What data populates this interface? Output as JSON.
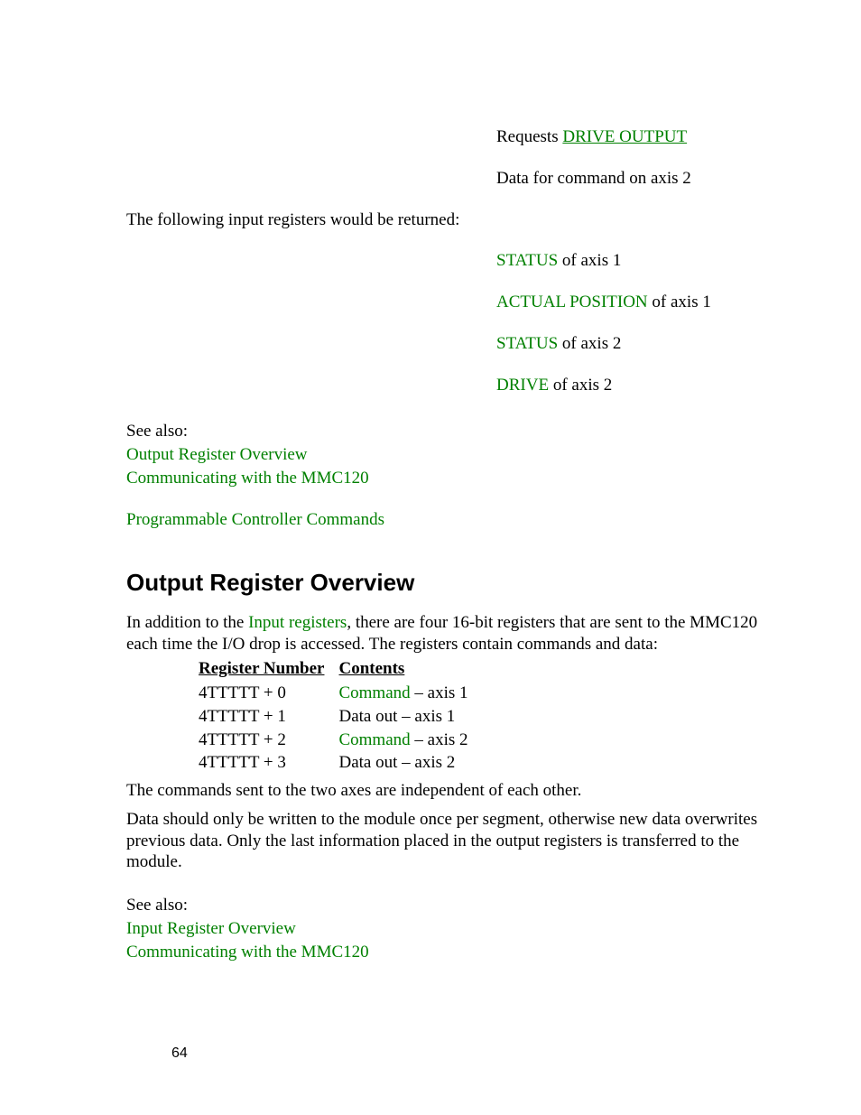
{
  "top_right": {
    "line1_prefix": "Requests ",
    "line1_link": "DRIVE OUTPUT",
    "line2": "Data for command on axis 2"
  },
  "intro_line": "The following input registers would be returned:",
  "returned_items": [
    {
      "term": "STATUS",
      "rest": " of axis 1"
    },
    {
      "term": "ACTUAL POSITION",
      "rest": " of axis 1"
    },
    {
      "term": "STATUS",
      "rest": " of axis 2"
    },
    {
      "term": "DRIVE",
      "rest": " of axis 2"
    }
  ],
  "see_also_1": {
    "label": "See also:",
    "links": [
      "Output Register Overview",
      "Communicating with the MMC120"
    ],
    "extra_link": "Programmable Controller Commands"
  },
  "heading": "Output Register Overview",
  "body_p1_pre": "In addition to the ",
  "body_p1_link": "Input registers",
  "body_p1_post": ", there are four 16-bit registers that are sent to the MMC120 each time the I/O drop is accessed.  The registers contain commands and data:",
  "table": {
    "headers": [
      "Register Number",
      "Contents"
    ],
    "rows": [
      {
        "reg": "4TTTTT + 0",
        "content_link": "Command",
        "content_rest": " – axis 1"
      },
      {
        "reg": "4TTTTT + 1",
        "content_link": "",
        "content_rest": "Data out – axis 1"
      },
      {
        "reg": "4TTTTT + 2",
        "content_link": "Command",
        "content_rest": " – axis 2"
      },
      {
        "reg": "4TTTTT + 3",
        "content_link": "",
        "content_rest": "Data out – axis 2"
      }
    ]
  },
  "body_p2": "The commands sent to the two axes are independent of each other.",
  "body_p3": "Data should only be written to the module once per segment, otherwise new data overwrites previous data.  Only the last information placed in the output registers is transferred to the module.",
  "see_also_2": {
    "label": "See also:",
    "links": [
      "Input Register Overview",
      "Communicating with the MMC120"
    ]
  },
  "page_number": "64"
}
